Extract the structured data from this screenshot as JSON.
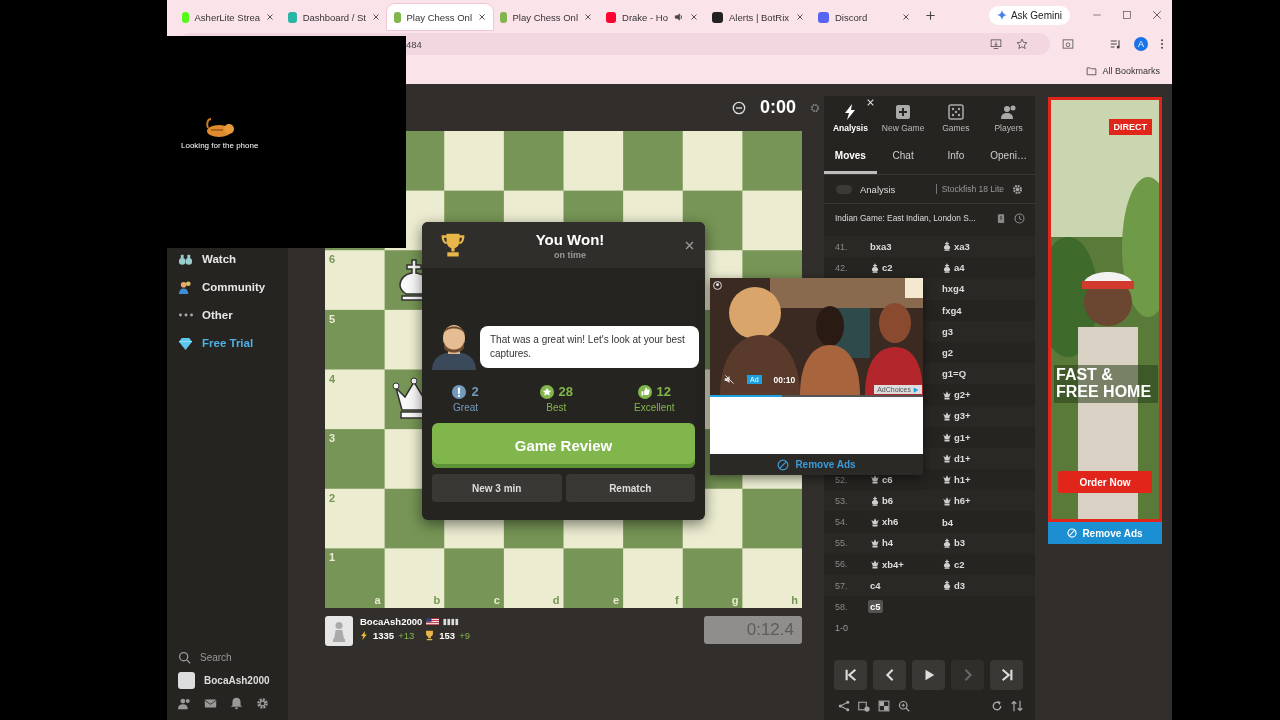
{
  "browser": {
    "tabs": [
      {
        "title": "AsherLite Strea",
        "color": "#53fc18",
        "selected": false,
        "audio": false
      },
      {
        "title": "Dashboard / St",
        "color": "#2ab5a5",
        "selected": false,
        "audio": false
      },
      {
        "title": "Play Chess Onl",
        "color": "#81b64c",
        "selected": true,
        "audio": false
      },
      {
        "title": "Play Chess Onl",
        "color": "#81b64c",
        "selected": false,
        "audio": false
      },
      {
        "title": "Drake - Ho",
        "color": "#ff0033",
        "selected": false,
        "audio": true
      },
      {
        "title": "Alerts | BotRix",
        "color": "#222222",
        "selected": false,
        "audio": false
      },
      {
        "title": "Discord",
        "color": "#5865f2",
        "selected": false,
        "audio": false
      }
    ],
    "gemini": "Ask Gemini",
    "address": "484",
    "profile": "A",
    "bookmarks": "All Bookmarks"
  },
  "stream_overlay": {
    "caption": "Looking for the phone"
  },
  "sidebar": {
    "items": [
      {
        "label": "Watch",
        "kind": "watch",
        "highlight": false
      },
      {
        "label": "Community",
        "kind": "community",
        "highlight": false
      },
      {
        "label": "Other",
        "kind": "other",
        "highlight": false
      },
      {
        "label": "Free Trial",
        "kind": "trial",
        "highlight": true
      }
    ],
    "search": "Search",
    "user": "BocaAsh2000"
  },
  "top_clock": "0:00",
  "board": {
    "ranks": [
      {
        "label": "6",
        "pieces": [
          {
            "kind": "none"
          },
          {
            "kind": "king"
          }
        ]
      },
      {
        "label": "5"
      },
      {
        "label": "4",
        "pieces": [
          {
            "kind": "none"
          },
          {
            "kind": "queen"
          }
        ]
      },
      {
        "label": "3"
      },
      {
        "label": "2"
      },
      {
        "label": "1"
      }
    ],
    "files": [
      "a",
      "b",
      "c",
      "d",
      "e",
      "f",
      "g",
      "h"
    ]
  },
  "player": {
    "name": "BocaAsh2000",
    "rating": "1335",
    "rating_change": "+13",
    "trophies": "153",
    "trophies_change": "+9",
    "clock": "0:12.4"
  },
  "modal": {
    "title": "You Won!",
    "subtitle": "on time",
    "message": "That was a great win! Let's look at your best captures.",
    "stats": [
      {
        "count": "2",
        "label": "Great",
        "color": "#749bbf",
        "kind": "exclaim"
      },
      {
        "count": "28",
        "label": "Best",
        "color": "#81b64c",
        "kind": "star"
      },
      {
        "count": "12",
        "label": "Excellent",
        "color": "#81b64c",
        "kind": "thumb"
      }
    ],
    "primary": "Game Review",
    "buttons": [
      "New 3 min",
      "Rematch"
    ]
  },
  "video_ad": {
    "badge": "Ad",
    "time": "00:10",
    "choices": "AdChoices",
    "level": 0.34,
    "remove": "Remove Ads"
  },
  "panel": {
    "nav": [
      {
        "label": "Analysis",
        "kind": "bolt",
        "selected": true
      },
      {
        "label": "New Game",
        "kind": "plus",
        "selected": false
      },
      {
        "label": "Games",
        "kind": "dice",
        "selected": false
      },
      {
        "label": "Players",
        "kind": "people",
        "selected": false
      }
    ],
    "tabs": [
      {
        "label": "Moves",
        "selected": true
      },
      {
        "label": "Chat",
        "selected": false
      },
      {
        "label": "Info",
        "selected": false
      },
      {
        "label": "Openi…",
        "selected": false
      }
    ],
    "analysis": {
      "label": "Analysis",
      "on": false,
      "engine": "Stockfish 18 Lite"
    },
    "opening": "Indian Game: East Indian, London S...",
    "moves": [
      {
        "number": "41.",
        "white": {
          "san": "bxa3",
          "selected": false
        },
        "black": {
          "kind": "king",
          "san": "xa3",
          "selected": false
        }
      },
      {
        "number": "42.",
        "white": {
          "kind": "king",
          "san": "c2",
          "selected": false
        },
        "black": {
          "kind": "king",
          "san": "a4",
          "selected": false
        }
      },
      {
        "black": {
          "san": "hxg4",
          "selected": false
        }
      },
      {
        "black": {
          "san": "fxg4",
          "selected": false
        }
      },
      {
        "black": {
          "san": "g3",
          "selected": false
        }
      },
      {
        "black": {
          "san": "g2",
          "selected": false
        }
      },
      {
        "black": {
          "san": "g1=Q",
          "selected": false
        }
      },
      {
        "black": {
          "kind": "queen",
          "san": "g2+",
          "selected": false
        }
      },
      {
        "black": {
          "kind": "queen",
          "san": "g3+",
          "selected": false
        }
      },
      {
        "black": {
          "kind": "queen",
          "san": "g1+",
          "selected": false
        }
      },
      {
        "black": {
          "kind": "queen",
          "san": "d1+",
          "selected": false
        }
      },
      {
        "number": "52.",
        "white": {
          "kind": "queen",
          "san": "c6",
          "selected": false
        },
        "black": {
          "kind": "queen",
          "san": "h1+",
          "selected": false
        }
      },
      {
        "number": "53.",
        "white": {
          "kind": "king",
          "san": "b6",
          "selected": false
        },
        "black": {
          "kind": "queen",
          "san": "h6+",
          "selected": false
        }
      },
      {
        "number": "54.",
        "white": {
          "kind": "queen",
          "san": "xh6",
          "selected": false
        },
        "black": {
          "san": "b4",
          "selected": false
        }
      },
      {
        "number": "55.",
        "white": {
          "kind": "queen",
          "san": "h4",
          "selected": false
        },
        "black": {
          "kind": "king",
          "san": "b3",
          "selected": false
        }
      },
      {
        "number": "56.",
        "white": {
          "kind": "queen",
          "san": "xb4+",
          "selected": false
        },
        "black": {
          "kind": "king",
          "san": "c2",
          "selected": false
        }
      },
      {
        "number": "57.",
        "white": {
          "san": "c4",
          "selected": false
        },
        "black": {
          "kind": "king",
          "san": "d3",
          "selected": false
        }
      },
      {
        "number": "58.",
        "white": {
          "san": "c5",
          "selected": true
        }
      }
    ],
    "result": "1-0",
    "controls": [
      {
        "kind": "first",
        "disabled": false
      },
      {
        "kind": "prev",
        "disabled": false
      },
      {
        "kind": "play",
        "disabled": false
      },
      {
        "kind": "next",
        "disabled": true
      },
      {
        "kind": "last",
        "disabled": false
      }
    ]
  },
  "side_ad": {
    "brand": "DIRECT",
    "headline": "FAST & FREE HOME",
    "cta": "Order Now",
    "remove": "Remove Ads"
  }
}
